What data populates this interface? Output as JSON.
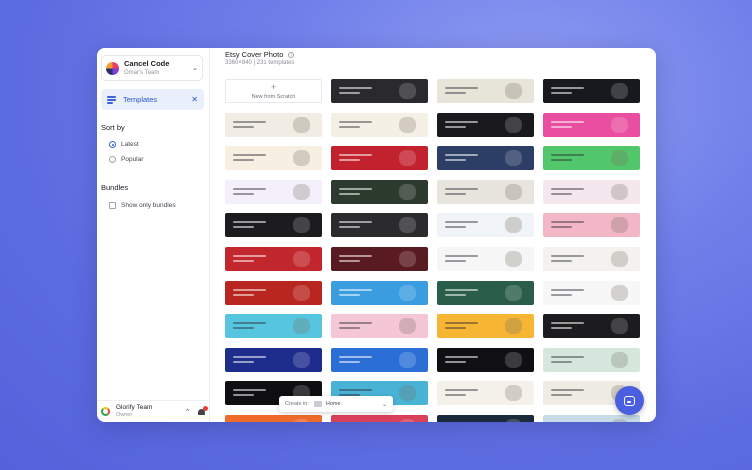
{
  "sidebar": {
    "workspace": {
      "title": "Cancel Code",
      "subtitle": "Omar's Team"
    },
    "nav_item": {
      "label": "Templates"
    },
    "sort_by": {
      "title": "Sort by",
      "options": [
        {
          "label": "Latest",
          "selected": true
        },
        {
          "label": "Popular",
          "selected": false
        }
      ]
    },
    "bundles": {
      "title": "Bundles",
      "checkbox_label": "Show only bundles",
      "checked": false
    },
    "footer": {
      "title": "Glorify Team",
      "subtitle": "Owner"
    }
  },
  "main": {
    "title": "Etsy Cover Photo",
    "meta": "3360×840 | 231 templates",
    "scratch_label": "New from Scratch",
    "template_colors": [
      [
        "#ffffff",
        "#2a2a2e",
        "#e7e4d9",
        "#16191d"
      ],
      [
        "#f1ede4",
        "#f5f0e6",
        "#1a1a1e",
        "#e94ea0"
      ],
      [
        "#f6efe2",
        "#c2222e",
        "#2c3e66",
        "#52c66a"
      ],
      [
        "#f3f0fb",
        "#2d3a2e",
        "#e8e4de",
        "#f4e8ee"
      ],
      [
        "#1c1c1e",
        "#2b2b2e",
        "#f0f3f7",
        "#f2b6c6"
      ],
      [
        "#c1272d",
        "#5a1a22",
        "#f6f6f6",
        "#f4f2ef"
      ],
      [
        "#b8261f",
        "#3a9de0",
        "#2a5d4a",
        "#f7f7f7"
      ],
      [
        "#56c5e0",
        "#f4c6d6",
        "#f6b533",
        "#1c1c1e"
      ],
      [
        "#1e2c8c",
        "#2b6fd6",
        "#101014",
        "#d6e8dd"
      ],
      [
        "#0f0f12",
        "#49b3d6",
        "#f4f1ea",
        "#efece3"
      ],
      [
        "#ef6b2c",
        "#d8415a",
        "#1a2a3a",
        "#c8dce8"
      ]
    ]
  },
  "create_bar": {
    "label": "Create in:",
    "value": "Home"
  }
}
